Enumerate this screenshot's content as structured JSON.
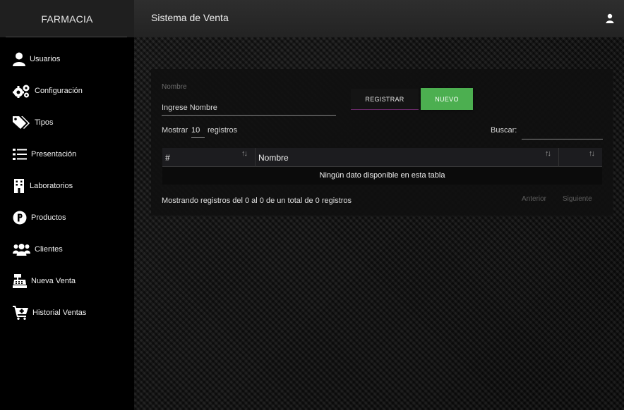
{
  "header": {
    "brand": "FARMACIA",
    "title": "Sistema de Venta",
    "user_icon": "user-icon"
  },
  "sidebar": {
    "items": [
      {
        "label": "Usuarios",
        "icon": "user-icon"
      },
      {
        "label": "Configuración",
        "icon": "gears-icon"
      },
      {
        "label": "Tipos",
        "icon": "tags-icon"
      },
      {
        "label": "Presentación",
        "icon": "list-icon"
      },
      {
        "label": "Laboratorios",
        "icon": "building-icon"
      },
      {
        "label": "Productos",
        "icon": "product-p-icon"
      },
      {
        "label": "Clientes",
        "icon": "users-icon"
      },
      {
        "label": "Nueva Venta",
        "icon": "cash-register-icon"
      },
      {
        "label": "Historial Ventas",
        "icon": "cart-plus-icon"
      }
    ]
  },
  "form": {
    "name_label": "Nombre",
    "name_placeholder": "Ingrese Nombre",
    "name_value": "",
    "register_button": "REGISTRAR",
    "new_button": "NUEVO",
    "new_button_color": "#4caf50"
  },
  "table": {
    "show_label": "Mostrar",
    "page_size": "10",
    "show_suffix": "registros",
    "search_label": "Buscar:",
    "search_value": "",
    "columns": [
      "#",
      "Nombre",
      ""
    ],
    "sort_icon": "sort-arrows-icon",
    "empty_message": "Ningún dato disponible en esta tabla",
    "info": "Mostrando registros del 0 al 0 de un total de 0 registros",
    "prev": "Anterior",
    "next": "Siguiente"
  }
}
